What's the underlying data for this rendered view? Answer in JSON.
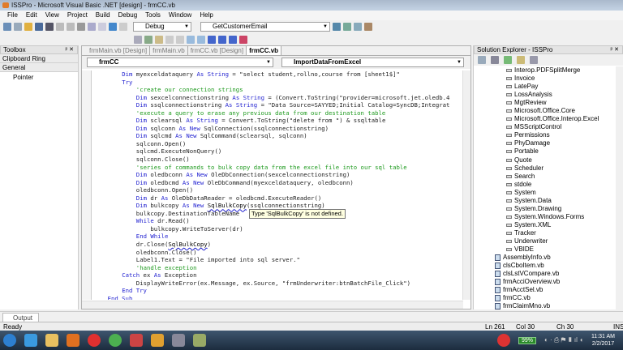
{
  "window": {
    "title": "ISSPro - Microsoft Visual Basic .NET [design] - frmCC.vb"
  },
  "menu": [
    "File",
    "Edit",
    "View",
    "Project",
    "Build",
    "Debug",
    "Tools",
    "Window",
    "Help"
  ],
  "toolbar": {
    "config": "Debug",
    "find": "GetCustomerEmail"
  },
  "toolbox": {
    "title": "Toolbox",
    "sections": [
      "Clipboard Ring",
      "General"
    ],
    "items": [
      "Pointer"
    ]
  },
  "editor": {
    "tabs": [
      "frmMain.vb [Design]",
      "frmMain.vb",
      "frmCC.vb [Design]",
      "frmCC.vb"
    ],
    "active_tab": 3,
    "class_combo": "frmCC",
    "method_combo": "ImportDataFromExcel",
    "tooltip": "Type 'SqlBulkCopy' is not defined.",
    "lines": [
      [
        2,
        [
          [
            "kw",
            "Dim "
          ],
          [
            "pl",
            "myexceldataquery "
          ],
          [
            "kw",
            "As String"
          ],
          [
            "pl",
            " = \"select student,rollno,course from [sheet1$]\""
          ]
        ]
      ],
      [
        2,
        [
          [
            "kw",
            "Try"
          ]
        ]
      ],
      [
        3,
        [
          [
            "cm",
            "'create our connection strings"
          ]
        ]
      ],
      [
        3,
        [
          [
            "kw",
            "Dim "
          ],
          [
            "pl",
            "sexcelconnectionstring "
          ],
          [
            "kw",
            "As String"
          ],
          [
            "pl",
            " = (Convert.ToString(\"provider=microsoft.jet.oledb.4"
          ]
        ]
      ],
      [
        3,
        [
          [
            "kw",
            "Dim "
          ],
          [
            "pl",
            "ssqlconnectionstring "
          ],
          [
            "kw",
            "As String"
          ],
          [
            "pl",
            " = \"Data Source=SAYYED;Initial Catalog=SyncDB;Integrat"
          ]
        ]
      ],
      [
        3,
        [
          [
            "cm",
            "'execute a query to erase any previous data from our destination table"
          ]
        ]
      ],
      [
        3,
        [
          [
            "kw",
            "Dim "
          ],
          [
            "pl",
            "sclearsql "
          ],
          [
            "kw",
            "As String"
          ],
          [
            "pl",
            " = Convert.ToString(\"delete from \") & ssqltable"
          ]
        ]
      ],
      [
        3,
        [
          [
            "kw",
            "Dim "
          ],
          [
            "pl",
            "sqlconn "
          ],
          [
            "kw",
            "As New "
          ],
          [
            "pl",
            "SqlConnection(ssqlconnectionstring)"
          ]
        ]
      ],
      [
        3,
        [
          [
            "kw",
            "Dim "
          ],
          [
            "pl",
            "sqlcmd "
          ],
          [
            "kw",
            "As New "
          ],
          [
            "pl",
            "SqlCommand(sclearsql, sqlconn)"
          ]
        ]
      ],
      [
        3,
        [
          [
            "pl",
            "sqlconn.Open()"
          ]
        ]
      ],
      [
        3,
        [
          [
            "pl",
            "sqlcmd.ExecuteNonQuery()"
          ]
        ]
      ],
      [
        3,
        [
          [
            "pl",
            "sqlconn.Close()"
          ]
        ]
      ],
      [
        3,
        [
          [
            "cm",
            "'series of commands to bulk copy data from the excel file into our sql table"
          ]
        ]
      ],
      [
        3,
        [
          [
            "kw",
            "Dim "
          ],
          [
            "pl",
            "oledbconn "
          ],
          [
            "kw",
            "As New "
          ],
          [
            "pl",
            "OleDbConnection(sexcelconnectionstring)"
          ]
        ]
      ],
      [
        3,
        [
          [
            "kw",
            "Dim "
          ],
          [
            "pl",
            "oledbcmd "
          ],
          [
            "kw",
            "As New "
          ],
          [
            "pl",
            "OleDbCommand(myexceldataquery, oledbconn)"
          ]
        ]
      ],
      [
        3,
        [
          [
            "pl",
            "oledbconn.Open()"
          ]
        ]
      ],
      [
        3,
        [
          [
            "kw",
            "Dim "
          ],
          [
            "pl",
            "dr "
          ],
          [
            "kw",
            "As "
          ],
          [
            "pl",
            "OleDbDataReader = oledbcmd.ExecuteReader()"
          ]
        ]
      ],
      [
        3,
        [
          [
            "kw",
            "Dim "
          ],
          [
            "pl",
            "bulkcopy "
          ],
          [
            "kw",
            "As New "
          ],
          [
            "err",
            "SqlBulkCopy"
          ],
          [
            "pl",
            "(ssqlconnectionstring)"
          ]
        ]
      ],
      [
        3,
        [
          [
            "pl",
            "bulkcopy.DestinationTableName"
          ]
        ]
      ],
      [
        3,
        [
          [
            "kw",
            "While "
          ],
          [
            "pl",
            "dr.Read()"
          ]
        ]
      ],
      [
        4,
        [
          [
            "pl",
            "bulkcopy.WriteToServer(dr)"
          ]
        ]
      ],
      [
        3,
        [
          [
            "kw",
            "End While"
          ]
        ]
      ],
      [
        3,
        [
          [
            "pl",
            "dr.Close("
          ],
          [
            "err",
            "SqlBulkCopy"
          ],
          [
            "pl",
            ")"
          ]
        ]
      ],
      [
        3,
        [
          [
            "pl",
            "oledbconn.Close()"
          ]
        ]
      ],
      [
        3,
        [
          [
            "pl",
            "Label1.Text = \"File imported into sql server.\""
          ]
        ]
      ],
      [
        3,
        [
          [
            "cm",
            "'handle exception"
          ]
        ]
      ],
      [
        2,
        [
          [
            "kw",
            "Catch "
          ],
          [
            "pl",
            "ex "
          ],
          [
            "kw",
            "As "
          ],
          [
            "pl",
            "Exception"
          ]
        ]
      ],
      [
        3,
        [
          [
            "pl",
            "DisplayWriteError(ex.Message, ex.Source, \"frmUnderwriter:btnBatchFile_Click\")"
          ]
        ]
      ],
      [
        2,
        [
          [
            "kw",
            "End Try"
          ]
        ]
      ],
      [
        1,
        [
          [
            "kw",
            "End Sub"
          ]
        ]
      ]
    ]
  },
  "solution": {
    "title": "Solution Explorer - ISSPro",
    "references": [
      "Interop.PDFSplitMerge",
      "Invoice",
      "LatePay",
      "LossAnalysis",
      "MgtReview",
      "Microsoft.Office.Core",
      "Microsoft.Office.Interop.Excel",
      "MSScriptControl",
      "Permissions",
      "PhyDamage",
      "Portable",
      "Quote",
      "Scheduler",
      "Search",
      "stdole",
      "System",
      "System.Data",
      "System.Drawing",
      "System.Windows.Forms",
      "System.XML",
      "Tracker",
      "Underwriter",
      "VBIDE"
    ],
    "files": [
      "AssemblyInfo.vb",
      "clsCboItem.vb",
      "clsLstVCompare.vb",
      "frmAcciOverview.vb",
      "frmAcctSel.vb",
      "frmCC.vb",
      "frmClaimMno.vb"
    ]
  },
  "output": {
    "tab": "Output"
  },
  "status": {
    "text": "Ready",
    "ln": "Ln 261",
    "col": "Col 30",
    "ch": "Ch 30",
    "mode": "INS"
  },
  "taskbar": {
    "battery": "99%",
    "time": "11:31 AM",
    "date": "2/2/2017"
  }
}
